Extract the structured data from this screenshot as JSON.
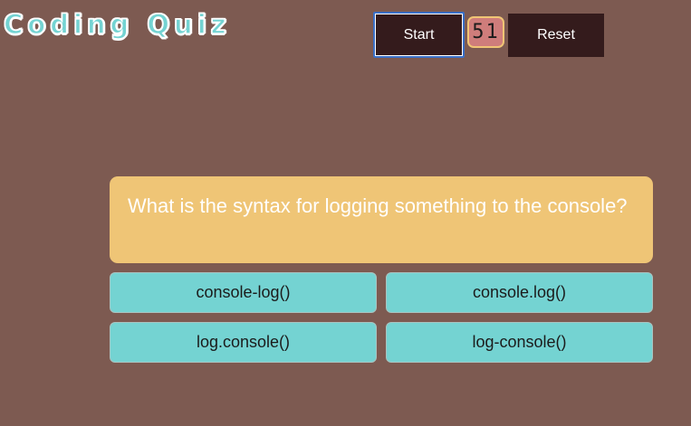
{
  "app": {
    "title": "Coding Quiz"
  },
  "controls": {
    "start_label": "Start",
    "reset_label": "Reset",
    "timer_value": "51"
  },
  "question": {
    "text": "What is the syntax for logging something to the console?"
  },
  "answers": [
    {
      "label": "console-log()"
    },
    {
      "label": "console.log()"
    },
    {
      "label": "log.console()"
    },
    {
      "label": "log-console()"
    }
  ],
  "colors": {
    "background": "#7d5a51",
    "title_fill": "#74d3d2",
    "button_dark": "#341b1c",
    "timer_bg": "#cf7d7b",
    "timer_border": "#f0c575",
    "question_bg": "#efc576",
    "answer_bg": "#74d3d2"
  }
}
